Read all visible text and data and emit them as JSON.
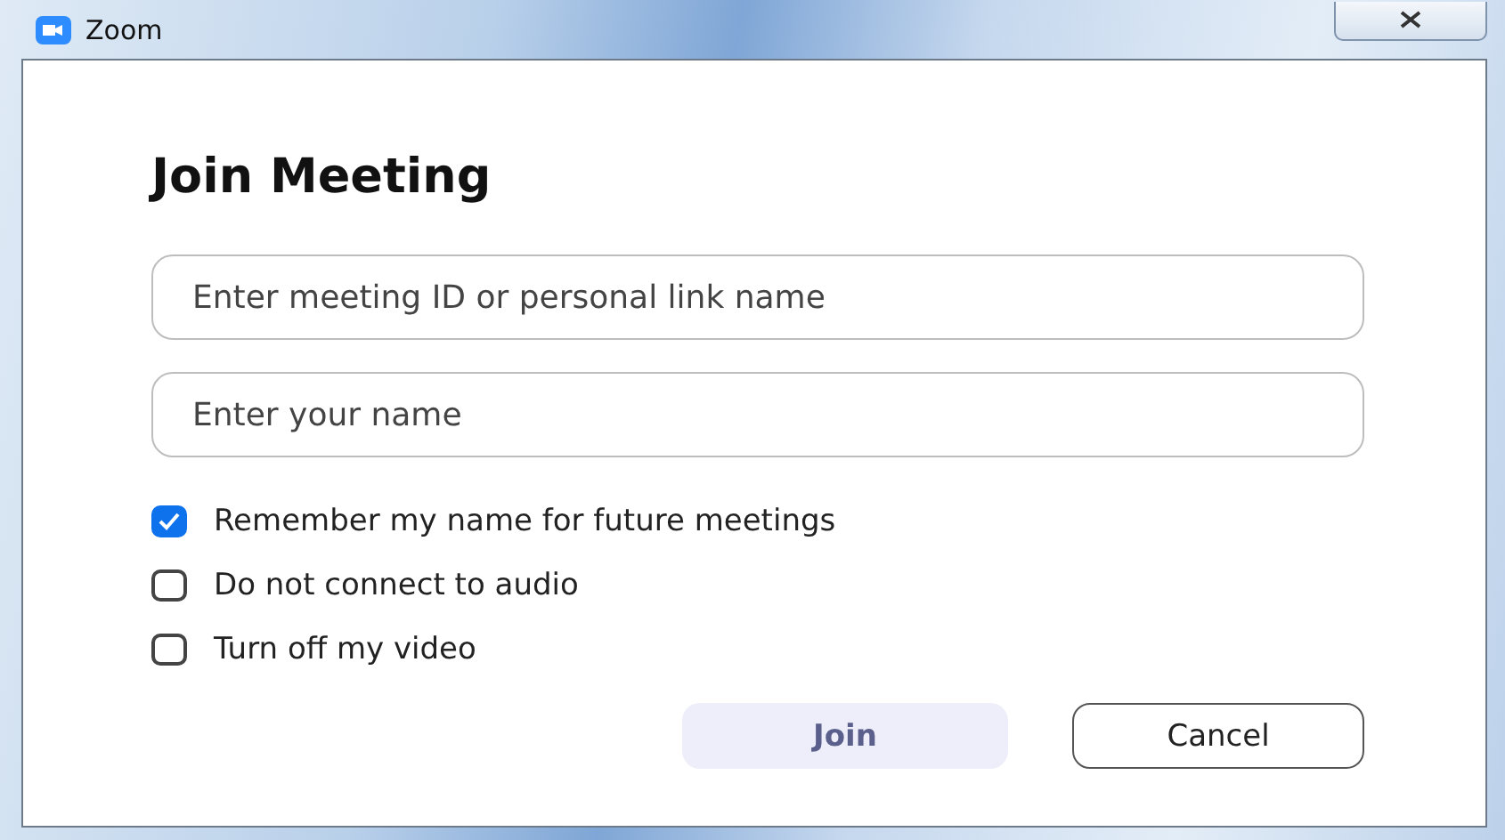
{
  "window": {
    "title": "Zoom"
  },
  "heading": "Join Meeting",
  "fields": [
    {
      "placeholder": "Enter meeting ID or personal link name"
    },
    {
      "placeholder": "Enter your name"
    }
  ],
  "options": [
    {
      "label": "Remember my name for future meetings",
      "checked": true
    },
    {
      "label": "Do not connect to audio",
      "checked": false
    },
    {
      "label": "Turn off my video",
      "checked": false
    }
  ],
  "buttons": [
    {
      "label": "Join",
      "kind": "primary",
      "disabled": true
    },
    {
      "label": "Cancel",
      "kind": "secondary",
      "disabled": false
    }
  ]
}
